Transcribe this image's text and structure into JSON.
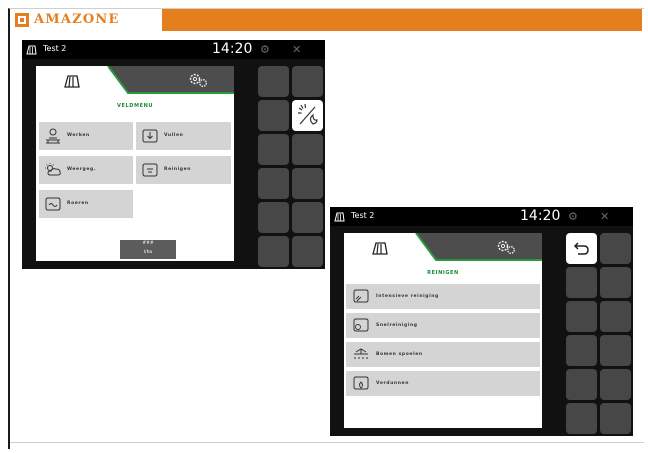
{
  "brand": {
    "name": "AMAZONE",
    "color": "#e57e1c",
    "icon": "amazone-logo"
  },
  "screens": [
    {
      "id": "veldmenu",
      "status": {
        "title": "Test 2",
        "time": "14:20"
      },
      "menu_title": "VELDMENU",
      "tiles": [
        {
          "label": "Werken",
          "icon": "field-work-icon"
        },
        {
          "label": "Vullen",
          "icon": "fill-tank-icon"
        },
        {
          "label": "Weergeg.",
          "icon": "weather-icon"
        },
        {
          "label": "Reinigen",
          "icon": "clean-tank-icon"
        },
        {
          "label": "Roeren",
          "icon": "stir-tank-icon"
        }
      ],
      "footer": {
        "line1": "###",
        "line2": "l/ha"
      },
      "side_buttons": [
        "day-night-icon"
      ]
    },
    {
      "id": "reinigen",
      "status": {
        "title": "Test 2",
        "time": "14:20"
      },
      "menu_title": "REINIGEN",
      "rows": [
        {
          "label": "Intensieve reiniging",
          "icon": "intensive-clean-icon"
        },
        {
          "label": "Snelreiniging",
          "icon": "quick-clean-icon"
        },
        {
          "label": "Bomen spoelen",
          "icon": "boom-rinse-icon"
        },
        {
          "label": "Verdunnen",
          "icon": "dilute-icon"
        }
      ],
      "side_buttons": [
        "back-icon"
      ]
    }
  ],
  "colors": {
    "accent_green": "#2a9a3c",
    "tile_gray": "#d4d4d4",
    "dark": "#111111"
  }
}
